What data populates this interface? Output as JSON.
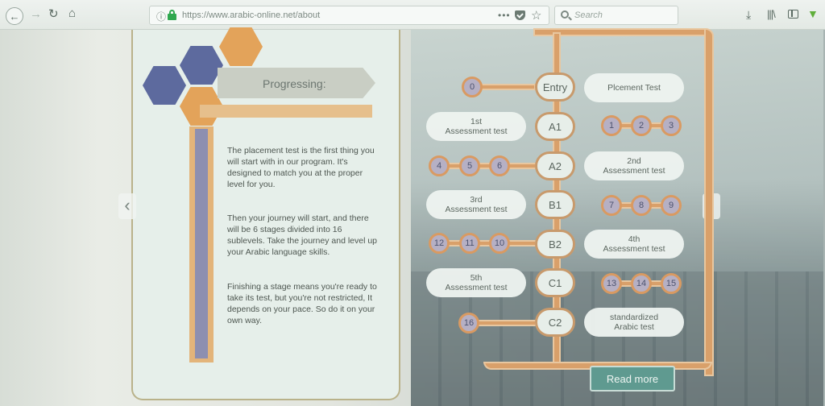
{
  "browser": {
    "url": "https://www.arabic-online.net/about",
    "url_dots": "•••",
    "search_placeholder": "Search"
  },
  "progress_panel": {
    "title": "Progressing:",
    "paragraphs": [
      "The placement test is the first thing you will start with in our program. It's designed to match you at the proper level for you.",
      "Then your journey will start, and there will be 6 stages divided into 16 sublevels. Take the journey and level up your Arabic language skills.",
      "Finishing a stage means you're ready to take its test, but you're not restricted, It depends on your pace. So do it on your own way."
    ]
  },
  "level_map": {
    "levels": [
      "Entry",
      "A1",
      "A2",
      "B1",
      "B2",
      "C1",
      "C2"
    ],
    "tests": {
      "entry": "Plcement Test",
      "a1_line1": "1st",
      "a1_line2": "Assessment test",
      "a2_line1": "2nd",
      "a2_line2": "Assessment test",
      "b1_line1": "3rd",
      "b1_line2": "Assessment test",
      "b2_line1": "4th",
      "b2_line2": "Assessment test",
      "c1_line1": "5th",
      "c1_line2": "Assessment test",
      "c2_line1": "standardized",
      "c2_line2": "Arabic test"
    },
    "sublevels": [
      "0",
      "1",
      "2",
      "3",
      "4",
      "5",
      "6",
      "7",
      "8",
      "9",
      "12",
      "11",
      "10",
      "13",
      "14",
      "15",
      "16"
    ]
  },
  "read_more_label": "Read more",
  "icons": {
    "back": "back-arrow-icon",
    "forward": "forward-arrow-icon",
    "reload": "reload-icon",
    "home": "home-icon",
    "prev": "chevron-left-icon",
    "next": "chevron-right-icon"
  },
  "colors": {
    "accent_orange": "#e3a35a",
    "accent_blue": "#5d6a9e",
    "button_teal": "#5f9a90"
  }
}
